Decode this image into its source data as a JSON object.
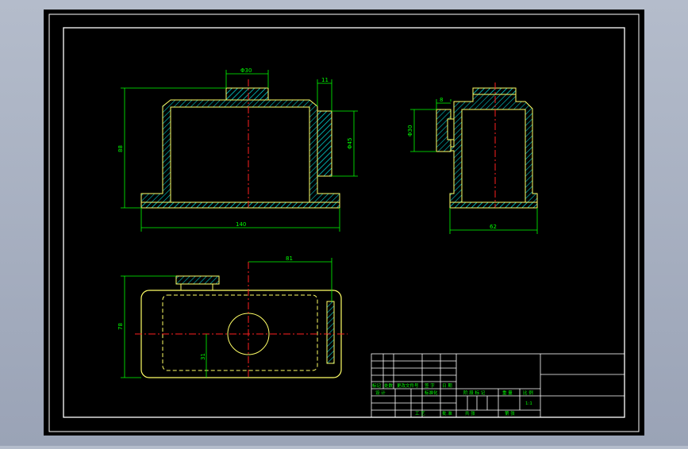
{
  "colors": {
    "background": "#000000",
    "frame": "#ffffff",
    "outline": "#ffff66",
    "hatch": "#00c8c8",
    "dimension": "#00ff00",
    "centerline": "#ff2020",
    "window_bg": "#a9b1c3"
  },
  "front_view": {
    "dim_top_boss": "Φ30",
    "dim_side_width": "11",
    "dim_height": "88",
    "dim_side_dia": "Φ45",
    "dim_total_width": "140"
  },
  "side_view": {
    "dim_flange": "8",
    "dim_bore": "Φ30",
    "dim_width": "62"
  },
  "top_view": {
    "dim_offset": "81",
    "dim_depth": "78",
    "dim_center": "31"
  },
  "title_block": {
    "rev_headers": [
      "标记",
      "处数",
      "更改文件号",
      "签 字",
      "日 期"
    ],
    "design_label": "设 计",
    "standard_label": "标准化",
    "stage_label": "阶 段 标 记",
    "weight_label": "重 量",
    "scale_label": "比 例",
    "scale_value": "1:1",
    "process_label": "工 艺",
    "approve_label": "批 准",
    "sheet_total_label": "共    张",
    "sheet_label": "第    张"
  }
}
